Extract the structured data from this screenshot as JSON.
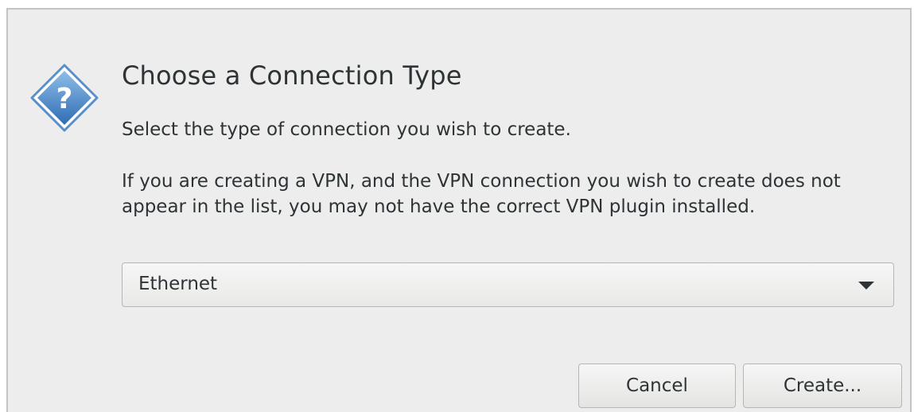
{
  "dialog": {
    "title": "Choose a Connection Type",
    "subtitle": "Select the type of connection you wish to create.",
    "note": "If you are creating a VPN, and the VPN connection you wish to create does not appear in the list, you may not have the correct VPN plugin installed.",
    "icon": "question-icon",
    "accent_color": "#3d7fc7"
  },
  "connection_type": {
    "selected": "Ethernet"
  },
  "buttons": {
    "cancel_label": "Cancel",
    "create_label": "Create..."
  }
}
